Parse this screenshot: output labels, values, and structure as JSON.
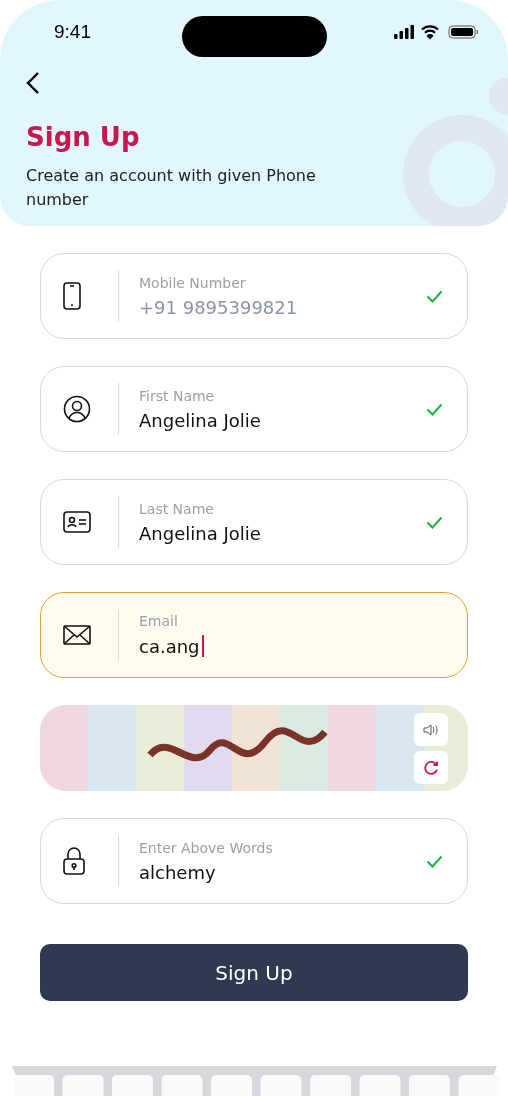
{
  "status_bar": {
    "time": "9:41"
  },
  "header": {
    "title": "Sign Up",
    "subtitle": "Create an account with given Phone number"
  },
  "fields": [
    {
      "kind": "phone",
      "label": "Mobile Number",
      "value": "+91 9895399821",
      "disabled": true,
      "focused": false,
      "valid": true
    },
    {
      "kind": "person",
      "label": "First Name",
      "value": "Angelina Jolie",
      "disabled": false,
      "focused": false,
      "valid": true
    },
    {
      "kind": "id-card",
      "label": "Last Name",
      "value": "Angelina Jolie",
      "disabled": false,
      "focused": false,
      "valid": true
    },
    {
      "kind": "mail",
      "label": "Email",
      "value": "ca.ang",
      "disabled": false,
      "focused": true,
      "valid": false
    }
  ],
  "answer_field": {
    "kind": "lock",
    "label": "Enter Above Words",
    "value": "alchemy",
    "disabled": false,
    "focused": false,
    "valid": true
  },
  "submit_button": "Sign Up"
}
